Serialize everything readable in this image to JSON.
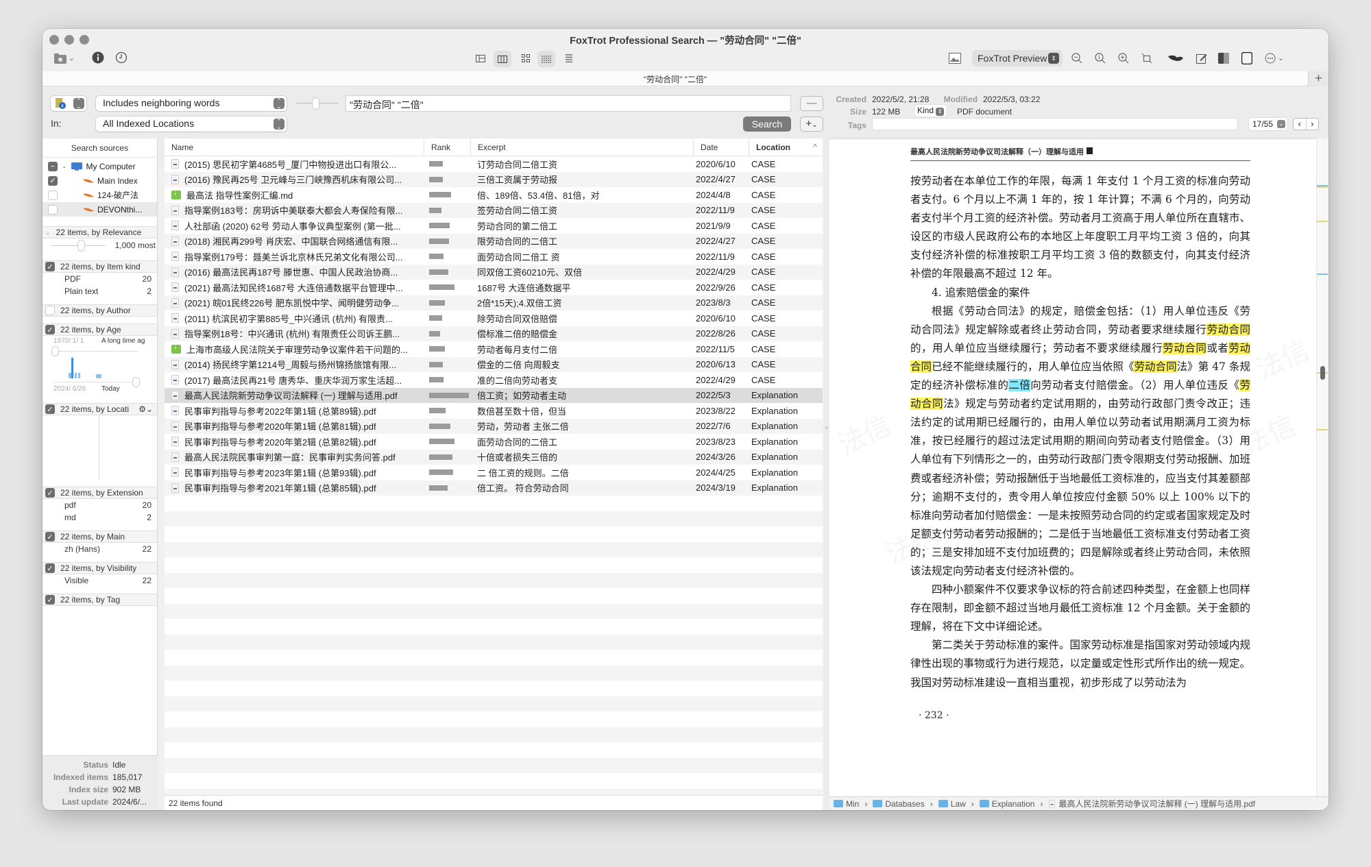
{
  "window": {
    "title": "FoxTrot Professional Search — \"劳动合同\" \"二倍\"",
    "tab_label": "\"劳动合同\" \"二倍\"",
    "add_tab": "+"
  },
  "toolbar": {
    "left_icons": [
      "index-settings-icon",
      "info-icon",
      "history-icon"
    ],
    "center_icons": [
      "sidebar-layout-icon",
      "columns-layout-icon",
      "grid-icon",
      "dense-list-icon",
      "list-icon"
    ],
    "preview_mode": "FoxTrot Preview",
    "right_icons": [
      "image-icon",
      "zoom-out-icon",
      "zoom-actual-icon",
      "zoom-in-icon",
      "crop-icon",
      "devonthink-icon",
      "edit-icon",
      "finder-icon",
      "fullscreen-icon",
      "more-icon"
    ]
  },
  "search": {
    "mode": "Includes neighboring words",
    "query": "\"劳动合同\" \"二倍\"",
    "in_label": "In:",
    "location": "All Indexed Locations",
    "search_button": "Search",
    "minus_button": "—",
    "plus_button": "+"
  },
  "sidebar": {
    "header": "Search sources",
    "sources": [
      {
        "label": "My Computer",
        "state": "mixed"
      },
      {
        "label": "Main Index",
        "state": "checked"
      },
      {
        "label": "124-破产法",
        "state": "unchecked"
      },
      {
        "label": "DEVONthi...",
        "state": "unchecked"
      }
    ],
    "relevance": {
      "title": "22 items, by Relevance",
      "value": "1,000 most"
    },
    "item_kind": {
      "title": "22 items, by Item kind",
      "rows": [
        {
          "label": "PDF",
          "count": "20"
        },
        {
          "label": "Plain text",
          "count": "2"
        }
      ]
    },
    "author": {
      "title": "22 items, by Author"
    },
    "age": {
      "title": "22 items, by Age",
      "from_date": "1970/ 1/ 1",
      "from_label": "A long time ag",
      "to_date": "2024/ 6/26",
      "to_label": "Today"
    },
    "location": {
      "title": "22 items, by Locati"
    },
    "extension": {
      "title": "22 items, by Extension",
      "rows": [
        {
          "label": "pdf",
          "count": "20"
        },
        {
          "label": "md",
          "count": "2"
        }
      ]
    },
    "main": {
      "title": "22 items, by Main",
      "rows": [
        {
          "label": "zh (Hans)",
          "count": "22"
        }
      ]
    },
    "visibility": {
      "title": "22 items, by Visibility",
      "rows": [
        {
          "label": "Visible",
          "count": "22"
        }
      ]
    },
    "tag": {
      "title": "22 items, by Tag"
    },
    "status": [
      {
        "k": "Status",
        "v": "Idle"
      },
      {
        "k": "Indexed items",
        "v": "185,017"
      },
      {
        "k": "Index size",
        "v": "902 MB"
      },
      {
        "k": "Last update",
        "v": "2024/6/..."
      }
    ]
  },
  "results": {
    "columns": [
      "Name",
      "Rank",
      "Excerpt",
      "Date",
      "Location"
    ],
    "footer": "22 items found",
    "rows": [
      {
        "name": "(2015) 思民初字第4685号_厦门中物投进出口有限公...",
        "type": "pdf",
        "rank": 0.35,
        "excerpt": "订劳动合同二倍工资",
        "date": "2020/6/10",
        "location": "CASE"
      },
      {
        "name": "(2016) 豫民再25号 卫元峰与三门峡豫西机床有限公司...",
        "type": "pdf",
        "rank": 0.35,
        "excerpt": "三倍工资属于劳动报",
        "date": "2022/4/27",
        "location": "CASE"
      },
      {
        "name": "最高法 指导性案例汇编.md",
        "type": "md",
        "rank": 0.55,
        "excerpt": "倍、189倍、53.4倍、81倍，对",
        "date": "2024/4/8",
        "location": "CASE"
      },
      {
        "name": "指导案例183号：房玥诉中美联泰大都会人寿保险有限...",
        "type": "pdf",
        "rank": 0.31,
        "excerpt": "签劳动合同二倍工资",
        "date": "2022/11/9",
        "location": "CASE"
      },
      {
        "name": "人社部函 (2020) 62号 劳动人事争议典型案例 (第一批...",
        "type": "pdf",
        "rank": 0.52,
        "excerpt": "劳动合同的第二倍工",
        "date": "2021/9/9",
        "location": "CASE"
      },
      {
        "name": "(2018) 湘民再299号 肖庆宏、中国联合网络通信有限...",
        "type": "pdf",
        "rank": 0.5,
        "excerpt": "限劳动合同的二倍工",
        "date": "2022/4/27",
        "location": "CASE"
      },
      {
        "name": "指导案例179号：聂美兰诉北京林氏兄弟文化有限公司...",
        "type": "pdf",
        "rank": 0.37,
        "excerpt": "面劳动合同二倍工 资",
        "date": "2022/11/9",
        "location": "CASE"
      },
      {
        "name": "(2016) 最高法民再187号 滕世惠、中国人民政治协商...",
        "type": "pdf",
        "rank": 0.49,
        "excerpt": "同双倍工资60210元、双倍",
        "date": "2022/4/29",
        "location": "CASE"
      },
      {
        "name": "(2021) 最高法知民终1687号 大连倍通数据平台管理中...",
        "type": "pdf",
        "rank": 0.63,
        "excerpt": "1687号 大连倍通数据平",
        "date": "2022/9/26",
        "location": "CASE"
      },
      {
        "name": "(2021) 皖01民终226号 肥东凯悦中学、闻明健劳动争...",
        "type": "pdf",
        "rank": 0.39,
        "excerpt": "2倍*15天);4.双倍工资",
        "date": "2023/8/3",
        "location": "CASE"
      },
      {
        "name": "(2011) 杭滨民初字第885号_中兴通讯 (杭州) 有限责...",
        "type": "pdf",
        "rank": 0.32,
        "excerpt": "除劳动合同双倍赔偿",
        "date": "2020/6/10",
        "location": "CASE"
      },
      {
        "name": "指导案例18号：中兴通讯 (杭州) 有限责任公司诉王鹏...",
        "type": "pdf",
        "rank": 0.28,
        "excerpt": "偿标准二倍的赔偿金",
        "date": "2022/8/26",
        "location": "CASE"
      },
      {
        "name": "上海市高级人民法院关于审理劳动争议案件若干问题的...",
        "type": "md",
        "rank": 0.39,
        "excerpt": "劳动者每月支付二倍",
        "date": "2022/11/5",
        "location": "CASE"
      },
      {
        "name": "(2014) 扬民终字第1214号_周毅与扬州锦扬旅馆有限...",
        "type": "pdf",
        "rank": 0.34,
        "excerpt": "偿金的二倍 向周毅支",
        "date": "2020/6/13",
        "location": "CASE"
      },
      {
        "name": "(2017) 最高法民再21号 唐秀华、重庆华润万家生活超...",
        "type": "pdf",
        "rank": 0.37,
        "excerpt": "准的二倍向劳动者支",
        "date": "2022/4/29",
        "location": "CASE"
      },
      {
        "name": "最高人民法院新劳动争议司法解释 (一) 理解与适用.pdf",
        "type": "pdf",
        "rank": 1.0,
        "excerpt": "倍工资；如劳动者主动",
        "date": "2022/5/3",
        "location": "Explanation",
        "selected": true
      },
      {
        "name": "民事审判指导与参考2022年第1辑 (总第89辑).pdf",
        "type": "pdf",
        "rank": 0.41,
        "excerpt": "数倍甚至数十倍，但当",
        "date": "2023/8/22",
        "location": "Explanation"
      },
      {
        "name": "民事审判指导与参考2020年第1辑 (总第81辑).pdf",
        "type": "pdf",
        "rank": 0.54,
        "excerpt": "劳动，劳动者 主张二倍",
        "date": "2022/7/6",
        "location": "Explanation"
      },
      {
        "name": "民事审判指导与参考2020年第2辑 (总第82辑).pdf",
        "type": "pdf",
        "rank": 0.63,
        "excerpt": "面劳动合同的二倍工",
        "date": "2023/8/23",
        "location": "Explanation"
      },
      {
        "name": "最高人民法院民事审判第一庭：民事审判实务问答.pdf",
        "type": "pdf",
        "rank": 0.59,
        "excerpt": "十倍或者损失三倍的",
        "date": "2024/3/26",
        "location": "Explanation"
      },
      {
        "name": "民事审判指导与参考2023年第1辑 (总第93辑).pdf",
        "type": "pdf",
        "rank": 0.61,
        "excerpt": "二 倍工资的规则。二倍",
        "date": "2024/4/25",
        "location": "Explanation"
      },
      {
        "name": "民事审判指导与参考2021年第1辑 (总第85辑).pdf",
        "type": "pdf",
        "rank": 0.46,
        "excerpt": "倍工资。 符合劳动合同",
        "date": "2024/3/19",
        "location": "Explanation"
      }
    ]
  },
  "preview": {
    "created_label": "Created",
    "created": "2022/5/2, 21:28",
    "modified_label": "Modified",
    "modified": "2022/5/3, 03:22",
    "size_label": "Size",
    "size": "122 MB",
    "kind_label": "Kind",
    "kind": "PDF document",
    "tags_label": "Tags",
    "hit_counter": "17/55",
    "page_header": "最高人民法院新劳动争议司法解释（一）理解与适用",
    "page_number": "· 232 ·",
    "paragraphs": {
      "p1": "按劳动者在本单位工作的年限，每满 1 年支付 1 个月工资的标准向劳动者支付。6 个月以上不满 1 年的，按 1 年计算；不满 6 个月的，向劳动者支付半个月工资的经济补偿。劳动者月工资高于用人单位所在直辖市、设区的市级人民政府公布的本地区上年度职工月平均工资 3 倍的，向其支付经济补偿的标准按职工月平均工资 3 倍的数额支付，向其支付经济补偿的年限最高不超过 12 年。",
      "heading": "4. 追索赔偿金的案件",
      "p2a": "根据《劳动合同法》的规定，赔偿金包括：（1）用人单位违反《劳动合同法》规定解除或者终止劳动合同，劳动者要求继续履行",
      "p2_hl1": "劳动合同",
      "p2b": "的，用人单位应当继续履行；劳动者不要求继续履行",
      "p2_hl2": "劳动合同",
      "p2c": "或者",
      "p2_hl3": "劳动合同",
      "p2d": "已经不能继续履行的，用人单位应当依照《",
      "p2_hl4": "劳动合同",
      "p2e": "法》第 47 条规定的经济补偿标准的",
      "p2_hl5": "二倍",
      "p2f": "向劳动者支付赔偿金。（2）用人单位违反《",
      "p2_hl6": "劳动合同",
      "p2g": "法》规定与劳动者约定试用期的，由劳动行政部门责令改正；违法约定的试用期已经履行的，由用人单位以劳动者试用期满月工资为标准，按已经履行的超过法定试用期的期间向劳动者支付赔偿金。（3）用人单位有下列情形之一的，由劳动行政部门责令限期支付劳动报酬、加班费或者经济补偿；劳动报酬低于当地最低工资标准的，应当支付其差额部分；逾期不支付的，责令用人单位按应付金额 50% 以上 100% 以下的标准向劳动者加付赔偿金：一是未按照劳动合同的约定或者国家规定及时足额支付劳动者劳动报酬的；二是低于当地最低工资标准支付劳动者工资的；三是安排加班不支付加班费的；四是解除或者终止劳动合同，未依照该法规定向劳动者支付经济补偿的。",
      "p3": "四种小额案件不仅要求争议标的符合前述四种类型，在金额上也同样存在限制，即金额不超过当地月最低工资标准 12 个月金额。关于金额的理解，将在下文中详细论述。",
      "p4": "第二类关于劳动标准的案件。国家劳动标准是指国家对劳动领域内规律性出现的事物或行为进行规范，以定量或定性形式所作出的统一规定。我国对劳动标准建设一直相当重视，初步形成了以劳动法为"
    },
    "watermark": "法信",
    "path": [
      "Min",
      "Databases",
      "Law",
      "Explanation",
      "最高人民法院新劳动争议司法解释 (一) 理解与适用.pdf"
    ]
  },
  "colors": {
    "highlight_yellow": "#fdf35c",
    "highlight_cyan": "#7ee9ff",
    "search_button": "#7a7a7a",
    "folder_blue": "#64b3ea"
  }
}
